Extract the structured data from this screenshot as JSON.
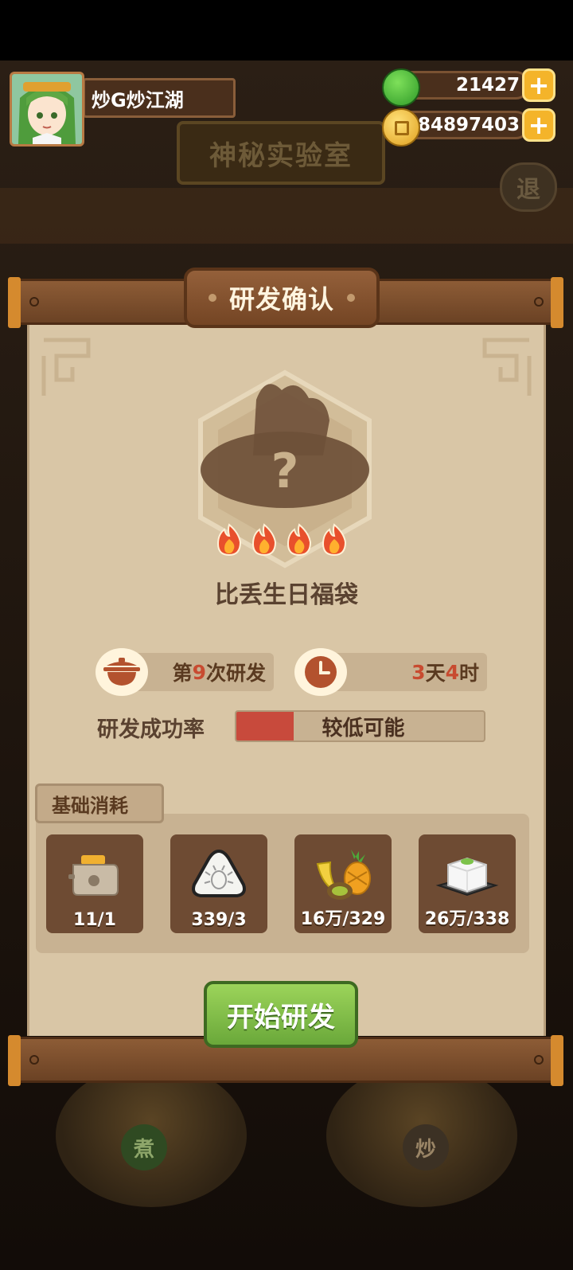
{
  "player": {
    "name": "炒G炒江湖"
  },
  "resources": {
    "jade": "21427",
    "coins": "84897403"
  },
  "background": {
    "lab_title": "神秘实验室",
    "exit_label": "退",
    "boil_label": "煮",
    "fry_label": "炒"
  },
  "dialog": {
    "title": "研发确认",
    "dish_name": "比丢生日福袋",
    "difficulty_flames": 4,
    "attempt": {
      "prefix": "第",
      "number": "9",
      "suffix": "次研发"
    },
    "time": {
      "days": "3",
      "day_unit": "天",
      "hours": "4",
      "hour_unit": "时"
    },
    "success_rate": {
      "label": "研发成功率",
      "text": "较低可能",
      "fill_fraction": 0.23
    },
    "base_cost": {
      "label": "基础消耗",
      "items": [
        {
          "icon": "toaster-icon",
          "count": "11/1"
        },
        {
          "icon": "crab-riceball-icon",
          "count": "339/3"
        },
        {
          "icon": "fruit-basket-icon",
          "count": "16万/329"
        },
        {
          "icon": "tofu-plate-icon",
          "count": "26万/338"
        }
      ]
    },
    "start_button": "开始研发"
  },
  "colors": {
    "accent_red": "#c84b30",
    "start_green": "#7cbc44",
    "coin_gold": "#f4b42a"
  }
}
